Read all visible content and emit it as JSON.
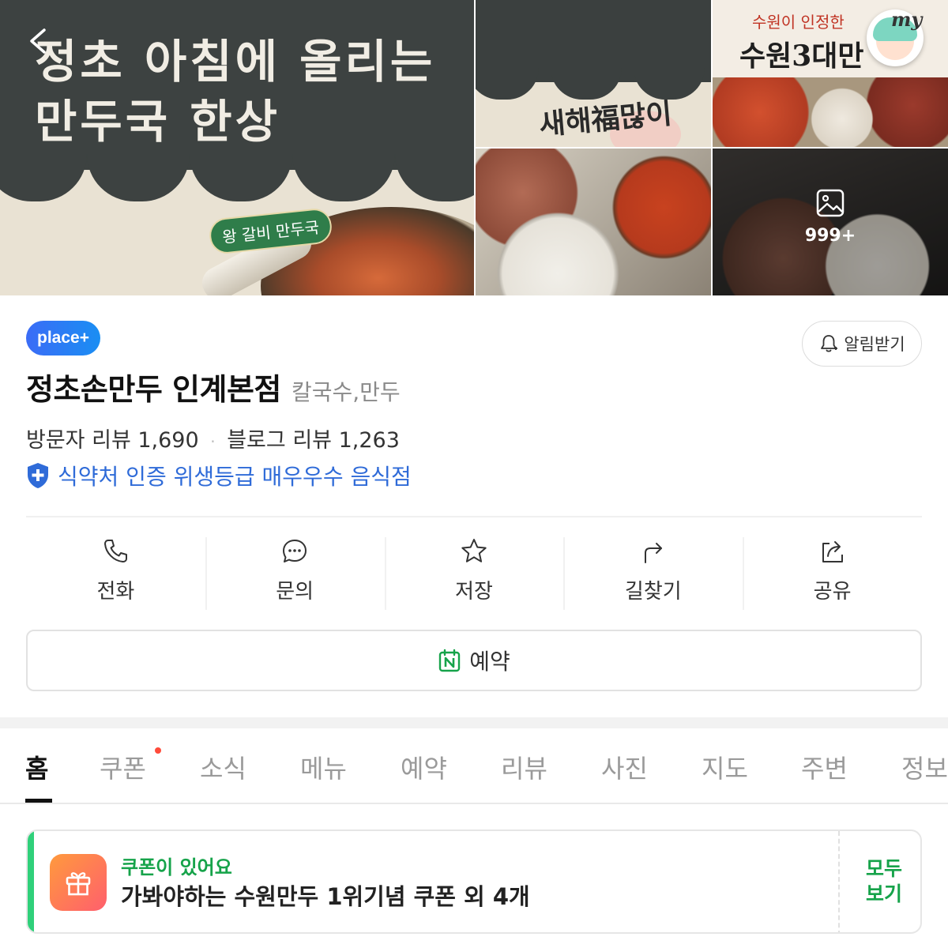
{
  "gallery": {
    "main_headline_line1": "정초 아침에 올리는",
    "main_headline_line2": "만두국 한상",
    "main_tag": "왕 갈비 만두국",
    "tile1_text": "새해福많이",
    "tile2_small": "수원이 인정한",
    "tile2_big": "수원3대만",
    "more_count": "999+",
    "my_label": "my"
  },
  "place": {
    "badge": "place+",
    "alarm_label": "알림받기",
    "name": "정초손만두 인계본점",
    "category": "칼국수,만두",
    "visitor_review": "방문자 리뷰 1,690",
    "blog_review": "블로그 리뷰 1,263",
    "separator": "·",
    "hygiene": "식약처 인증 위생등급 매우우수 음식점"
  },
  "actions": [
    {
      "label": "전화",
      "icon": "phone-icon"
    },
    {
      "label": "문의",
      "icon": "chat-icon"
    },
    {
      "label": "저장",
      "icon": "star-icon"
    },
    {
      "label": "길찾기",
      "icon": "directions-icon"
    },
    {
      "label": "공유",
      "icon": "share-icon"
    }
  ],
  "reserve": {
    "label": "예약",
    "icon": "naver-calendar-icon"
  },
  "tabs": [
    "홈",
    "쿠폰",
    "소식",
    "메뉴",
    "예약",
    "리뷰",
    "사진",
    "지도",
    "주변",
    "정보"
  ],
  "coupon": {
    "kicker": "쿠폰이 있어요",
    "main": "가봐야하는 수원만두 1위기념 쿠폰 외 4개",
    "see_all_line1": "모두",
    "see_all_line2": "보기"
  },
  "colors": {
    "accent_green": "#16a34a",
    "place_badge": "#3b6cf6",
    "hygiene_blue": "#2f6bd8",
    "tab_dot": "#ff4b3a"
  }
}
